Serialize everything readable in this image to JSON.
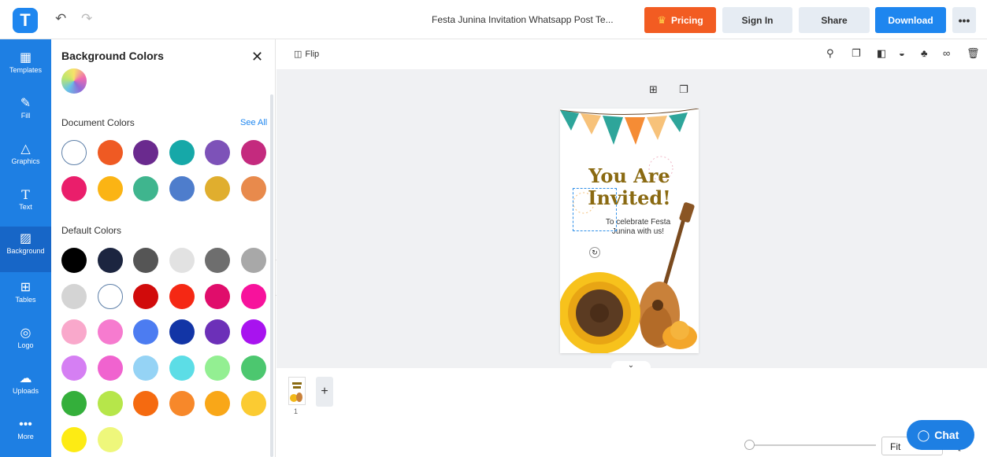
{
  "topbar": {
    "logo_letter": "T",
    "doc_title": "Festa Junina Invitation Whatsapp Post Te...",
    "pricing": "Pricing",
    "sign_in": "Sign In",
    "share": "Share",
    "download": "Download",
    "more": "•••"
  },
  "rail": [
    {
      "label": "Templates",
      "icon": "templates-icon"
    },
    {
      "label": "Fill",
      "icon": "brush-icon"
    },
    {
      "label": "Graphics",
      "icon": "shapes-icon"
    },
    {
      "label": "Text",
      "icon": "text-icon"
    },
    {
      "label": "Background",
      "icon": "background-icon",
      "active": true
    },
    {
      "label": "Tables",
      "icon": "table-icon"
    },
    {
      "label": "Logo",
      "icon": "logo-icon"
    },
    {
      "label": "Uploads",
      "icon": "cloud-upload-icon"
    },
    {
      "label": "More",
      "icon": "more-icon"
    }
  ],
  "panel": {
    "title": "Background Colors",
    "document_colors_label": "Document Colors",
    "see_all": "See All",
    "default_colors_label": "Default Colors",
    "document_colors": [
      "#ffffff",
      "#ef5a23",
      "#6a2a8e",
      "#16a8a8",
      "#7d52b8",
      "#c42a7e",
      "#ea1e6b",
      "#fbb414",
      "#3fb58e",
      "#4e7dcc",
      "#e0ae2e",
      "#e88a4c"
    ],
    "default_colors": [
      "#000000",
      "#1c2540",
      "#555555",
      "#e2e2e2",
      "#6e6e6e",
      "#a8a8a8",
      "#d4d4d4",
      "#ffffff",
      "#d10b0b",
      "#f52814",
      "#e00d6b",
      "#f7129c",
      "#f9a8cb",
      "#f67bcf",
      "#4c7cf1",
      "#1235a6",
      "#6c30b8",
      "#a813ef",
      "#d57ff3",
      "#f063cf",
      "#95d3f5",
      "#5cdde6",
      "#93ef92",
      "#4cc76f",
      "#34af3b",
      "#b6e64a",
      "#f56a10",
      "#f7882a",
      "#f9a718",
      "#fbcb32",
      "#fdeb14",
      "#eef77b"
    ]
  },
  "canvas": {
    "flip": "Flip",
    "design": {
      "line1": "You Are",
      "line2": "Invited!",
      "line3": "To celebrate Festa",
      "line4": "Junina with us!"
    },
    "page_number": "1",
    "zoom_label": "Fit"
  },
  "chat": "Chat"
}
